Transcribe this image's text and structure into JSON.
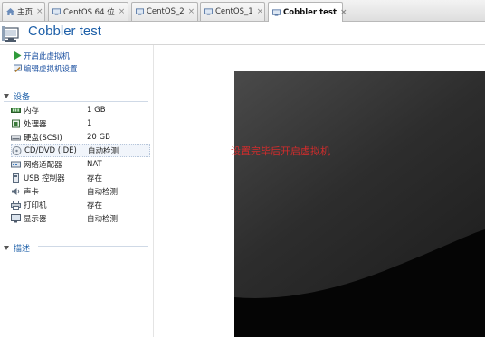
{
  "tabs": [
    {
      "label": "主页",
      "icon": "home-icon",
      "active": false
    },
    {
      "label": "CentOS 64 位",
      "icon": "vm-icon",
      "active": false
    },
    {
      "label": "CentOS_2",
      "icon": "vm-icon",
      "active": false
    },
    {
      "label": "CentOS_1",
      "icon": "vm-icon",
      "active": false
    },
    {
      "label": "Cobbler test",
      "icon": "vm-icon",
      "active": true
    }
  ],
  "tab_close_glyph": "×",
  "header": {
    "title": "Cobbler test"
  },
  "actions": {
    "power_on": "开启此虚拟机",
    "edit_settings": "编辑虚拟机设置"
  },
  "sections": {
    "devices": "设备",
    "description": "描述"
  },
  "devices": [
    {
      "name": "内存",
      "value": "1 GB",
      "icon": "memory-icon"
    },
    {
      "name": "处理器",
      "value": "1",
      "icon": "processor-icon"
    },
    {
      "name": "硬盘(SCSI)",
      "value": "20 GB",
      "icon": "hard-disk-icon"
    },
    {
      "name": "CD/DVD (IDE)",
      "value": "自动检测",
      "icon": "cd-dvd-icon"
    },
    {
      "name": "网络适配器",
      "value": "NAT",
      "icon": "network-adapter-icon"
    },
    {
      "name": "USB 控制器",
      "value": "存在",
      "icon": "usb-icon"
    },
    {
      "name": "声卡",
      "value": "自动检测",
      "icon": "sound-card-icon"
    },
    {
      "name": "打印机",
      "value": "存在",
      "icon": "printer-icon"
    },
    {
      "name": "显示器",
      "value": "自动检测",
      "icon": "display-icon"
    }
  ],
  "annotation": "设置完毕后开启虚拟机",
  "colors": {
    "accent": "#1d5fa8",
    "annotation": "#d22c2c",
    "screen_bg": "#262626"
  }
}
